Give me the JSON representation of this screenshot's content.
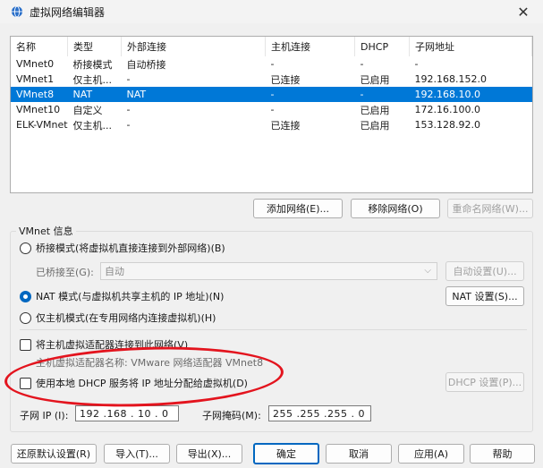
{
  "window": {
    "title": "虚拟网络编辑器",
    "close_glyph": "✕"
  },
  "table": {
    "columns": [
      "名称",
      "类型",
      "外部连接",
      "主机连接",
      "DHCP",
      "子网地址"
    ],
    "rows": [
      [
        "VMnet0",
        "桥接模式",
        "自动桥接",
        "-",
        "-",
        "-"
      ],
      [
        "VMnet1",
        "仅主机...",
        "-",
        "已连接",
        "已启用",
        "192.168.152.0"
      ],
      [
        "VMnet8",
        "NAT",
        "NAT",
        "-",
        "-",
        "192.168.10.0"
      ],
      [
        "VMnet10",
        "自定义",
        "-",
        "-",
        "已启用",
        "172.16.100.0"
      ],
      [
        "ELK-VMnet",
        "仅主机...",
        "-",
        "已连接",
        "已启用",
        "153.128.92.0"
      ]
    ],
    "selected_row": "VMnet8"
  },
  "list_buttons": {
    "add": "添加网络(E)...",
    "remove": "移除网络(O)",
    "rename": "重命名网络(W)..."
  },
  "vmnet_info": {
    "group_title": "VMnet 信息",
    "bridged_label": "桥接模式(将虚拟机直接连接到外部网络)(B)",
    "bridged_to_label": "已桥接至(G):",
    "bridged_to_value": "自动",
    "auto_settings": "自动设置(U)...",
    "nat_label": "NAT 模式(与虚拟机共享主机的 IP 地址)(N)",
    "nat_settings": "NAT 设置(S)...",
    "hostonly_label": "仅主机模式(在专用网络内连接虚拟机)(H)",
    "connect_adapter_label": "将主机虚拟适配器连接到此网络(V)",
    "adapter_name_label": "主机虚拟适配器名称: VMware 网络适配器 VMnet8",
    "dhcp_label": "使用本地 DHCP 服务将 IP 地址分配给虚拟机(D)",
    "dhcp_settings": "DHCP 设置(P)...",
    "subnet_ip_label": "子网 IP (I):",
    "subnet_ip_value": "192 .168 . 10 . 0",
    "subnet_mask_label": "子网掩码(M):",
    "subnet_mask_value": "255 .255 .255 . 0",
    "selected_mode": "nat",
    "connect_adapter_checked": false,
    "dhcp_checked": false
  },
  "footer": {
    "restore": "还原默认设置(R)",
    "import": "导入(T)...",
    "export": "导出(X)...",
    "ok": "确定",
    "cancel": "取消",
    "apply": "应用(A)",
    "help": "帮助"
  },
  "annotation_color": "#e3141e",
  "accent_color": "#0078d7"
}
